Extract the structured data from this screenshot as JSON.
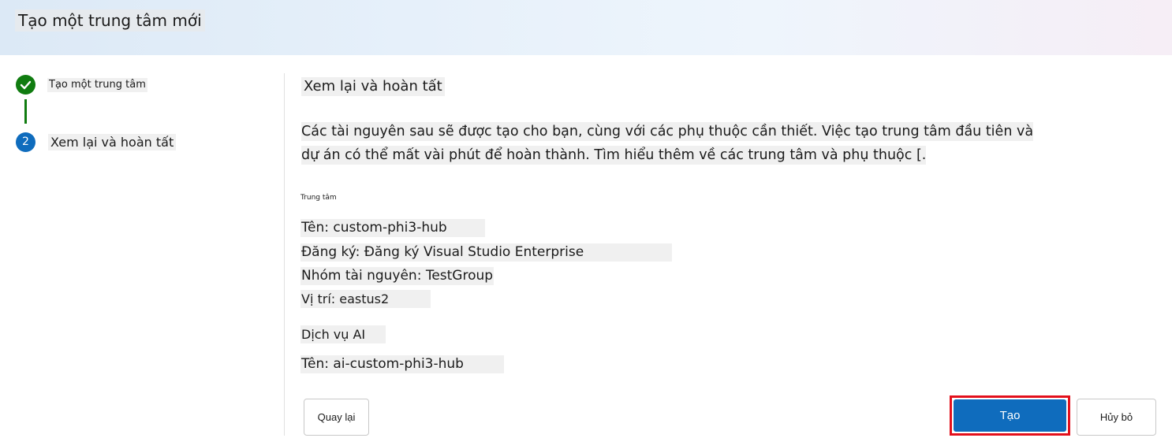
{
  "header": {
    "title": "Tạo một trung tâm mới"
  },
  "steps": [
    {
      "number": "✓",
      "label": "Tạo một trung tâm",
      "status": "completed"
    },
    {
      "number": "2",
      "label": "Xem lại và hoàn tất",
      "status": "current"
    }
  ],
  "main": {
    "section_title": "Xem lại và hoàn tất",
    "description_line1": "Các tài nguyên sau sẽ được tạo cho bạn, cùng với các phụ thuộc cần thiết. Việc tạo trung tâm đầu tiên và",
    "description_line2": "dự án có thể mất vài phút để hoàn thành. Tìm hiểu thêm về các trung tâm và phụ thuộc [.",
    "hub_section_label": "Trung tâm",
    "hub_name": "Tên: custom-phi3-hub",
    "hub_subscription": "Đăng ký: Đăng ký Visual Studio Enterprise",
    "hub_resource_group": "Nhóm tài nguyên: TestGroup",
    "hub_location": "Vị trí: eastus2",
    "ai_section_label": "Dịch vụ AI",
    "ai_name": "Tên: ai-custom-phi3-hub"
  },
  "buttons": {
    "back": "Quay lại",
    "create": "Tạo",
    "cancel": "Hủy bỏ"
  },
  "colors": {
    "accent": "#0f6cbd",
    "success": "#107c10",
    "highlight_border": "#e3101c"
  }
}
